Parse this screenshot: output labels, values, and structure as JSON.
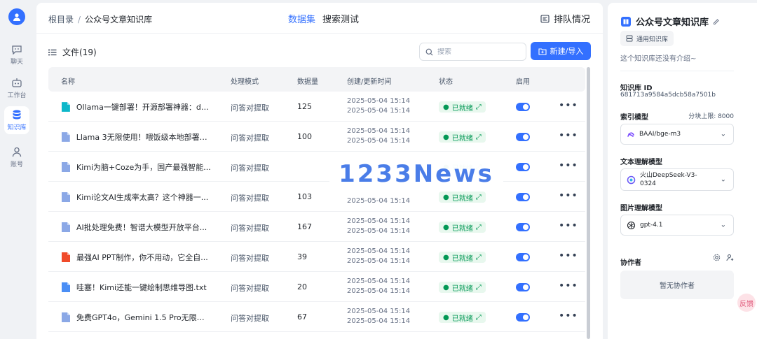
{
  "nav": {
    "items": [
      {
        "label": "聊天",
        "icon": "chat-icon"
      },
      {
        "label": "工作台",
        "icon": "robot-icon"
      },
      {
        "label": "知识库",
        "icon": "database-icon"
      },
      {
        "label": "账号",
        "icon": "user-icon"
      }
    ],
    "active": "知识库"
  },
  "header": {
    "breadcrumb_root": "根目录",
    "breadcrumb_sep": "/",
    "breadcrumb_current": "公众号文章知识库",
    "tabs": [
      "数据集",
      "搜索测试"
    ],
    "active_tab": "数据集",
    "queue_label": "排队情况"
  },
  "files": {
    "title": "文件(19)",
    "search_placeholder": "搜索",
    "new_button": "新建/导入",
    "columns": [
      "名称",
      "处理模式",
      "数据量",
      "创建/更新时间",
      "状态",
      "启用"
    ],
    "rows": [
      {
        "name": "Ollama一键部署！开源部署神器：do...",
        "type": "docx",
        "mode": "问答对提取",
        "count": "125",
        "created": "2025-05-04 15:14",
        "updated": "2025-05-04 15:14",
        "status": "已就绪",
        "enabled": true
      },
      {
        "name": "Llama 3无限使用！喂饭级本地部署教...",
        "type": "file",
        "mode": "问答对提取",
        "count": "100",
        "created": "2025-05-04 15:14",
        "updated": "2025-05-04 15:14",
        "status": "已就绪",
        "enabled": true
      },
      {
        "name": "Kimi为脑+Coze为手，国产最强智能...",
        "type": "file",
        "mode": "问答对提取",
        "count": "",
        "created": "",
        "updated": "",
        "status": "已就绪",
        "enabled": true
      },
      {
        "name": "Kimi论文AI生成率太高？这个神器一...",
        "type": "file",
        "mode": "问答对提取",
        "count": "103",
        "created": "",
        "updated": "2025-05-04 15:14",
        "status": "已就绪",
        "enabled": true
      },
      {
        "name": "AI批处理免费！智谱大模型开放平台...",
        "type": "file",
        "mode": "问答对提取",
        "count": "167",
        "created": "2025-05-04 15:14",
        "updated": "2025-05-04 15:14",
        "status": "已就绪",
        "enabled": true
      },
      {
        "name": "最强AI PPT制作，你不用动，它全自...",
        "type": "ppt",
        "mode": "问答对提取",
        "count": "39",
        "created": "2025-05-04 15:14",
        "updated": "2025-05-04 15:14",
        "status": "已就绪",
        "enabled": true
      },
      {
        "name": "哇塞！Kimi还能一键绘制思维导图.txt",
        "type": "txt",
        "mode": "问答对提取",
        "count": "20",
        "created": "2025-05-04 15:14",
        "updated": "2025-05-04 15:14",
        "status": "已就绪",
        "enabled": true
      },
      {
        "name": "免费GPT4o，Gemini 1.5 Pro无限续...",
        "type": "file",
        "mode": "问答对提取",
        "count": "67",
        "created": "2025-05-04 15:14",
        "updated": "2025-05-04 15:14",
        "status": "已就绪",
        "enabled": true
      }
    ]
  },
  "watermark": "1233News",
  "side": {
    "title": "公众号文章知识库",
    "kb_type": "通用知识库",
    "intro": "这个知识库还没有介绍~",
    "kb_id_label": "知识库 ID",
    "kb_id": "681713a9584a5dcb58a7501b",
    "index_model_label": "索引模型",
    "chunk_limit": "分块上限: 8000",
    "index_model": "BAAI/bge-m3",
    "text_model_label": "文本理解模型",
    "text_model": "火山DeepSeek-V3-0324",
    "image_model_label": "图片理解模型",
    "image_model": "gpt-4.1",
    "collab_label": "协作者",
    "collab_empty": "暂无协作者"
  },
  "float_button": "反馈",
  "colors": {
    "accent": "#3370ff",
    "ready": "#039855",
    "ready_bg": "#e8f8ee"
  }
}
